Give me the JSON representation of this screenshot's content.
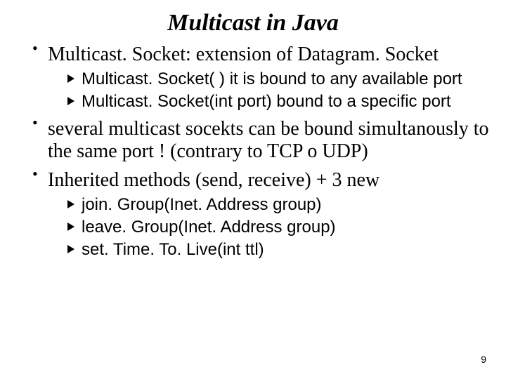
{
  "title": "Multicast in Java",
  "bullets": {
    "b1": {
      "text": "Multicast. Socket: extension of  Datagram. Socket",
      "sub": [
        "Multicast. Socket( ) it is bound to any available port",
        "Multicast. Socket(int port) bound to a specific port"
      ]
    },
    "b2": {
      "text": "several multicast socekts can be bound simultanously to the same port ! (contrary to TCP o UDP)"
    },
    "b3": {
      "text": "Inherited methods (send, receive) + 3 new",
      "sub": [
        "join. Group(Inet. Address group)",
        "leave. Group(Inet. Address group)",
        "set. Time. To. Live(int ttl)"
      ]
    }
  },
  "page_number": "9"
}
